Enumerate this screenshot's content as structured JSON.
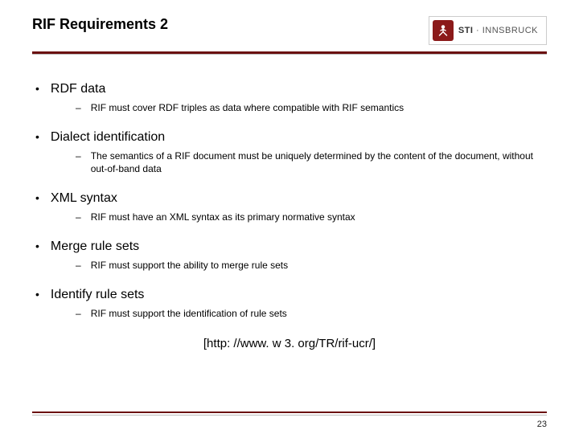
{
  "header": {
    "title": "RIF Requirements 2",
    "logo": {
      "name_bold": "STI",
      "name_rest": " · INNSBRUCK"
    }
  },
  "items": [
    {
      "label": "RDF data",
      "sub": "RIF must cover RDF triples as data where compatible with RIF semantics"
    },
    {
      "label": "Dialect identification",
      "sub": "The semantics of a RIF document must be uniquely determined by the content of the document, without out-of-band data"
    },
    {
      "label": "XML syntax",
      "sub": "RIF must have an XML syntax as its primary normative syntax"
    },
    {
      "label": "Merge rule sets",
      "sub": "RIF must support the ability to merge rule sets"
    },
    {
      "label": "Identify rule sets",
      "sub": "RIF must support the identification of rule sets"
    }
  ],
  "url": "[http: //www. w 3. org/TR/rif-ucr/]",
  "page_number": "23"
}
